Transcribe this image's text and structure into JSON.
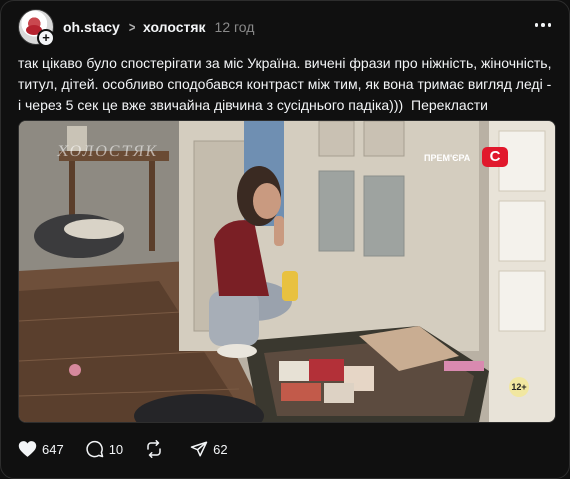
{
  "post": {
    "username": "oh.stacy",
    "community": "холостяк",
    "time": "12 год",
    "text": "так цікаво було спостерігати за міс Україна. вичені фрази про ніжність, жіночність, титул, дітей. особливо сподобався контраст між тим, як вона тримає вигляд леді - і через 5 сек це вже звичайна дівчина з сусіднього падіка)))",
    "translate_label": "Перекласти"
  },
  "media": {
    "watermark": "ХОЛОСТЯК",
    "premiere_label": "ПРЕМ'ЄРА",
    "channel_logo": "С",
    "age_rating": "12+"
  },
  "actions": {
    "likes": "647",
    "comments": "10",
    "reposts": "",
    "shares": "62"
  },
  "colors": {
    "background": "#101010",
    "text": "#f3f5f7",
    "muted": "#8a8a8a",
    "channel_red": "#e1182c"
  },
  "icons": {
    "like": "heart-icon",
    "comment": "comment-bubble-icon",
    "repost": "repost-icon",
    "share": "send-icon",
    "more": "more-dots-icon",
    "chevron": "chevron-right-icon",
    "follow": "plus-icon"
  }
}
